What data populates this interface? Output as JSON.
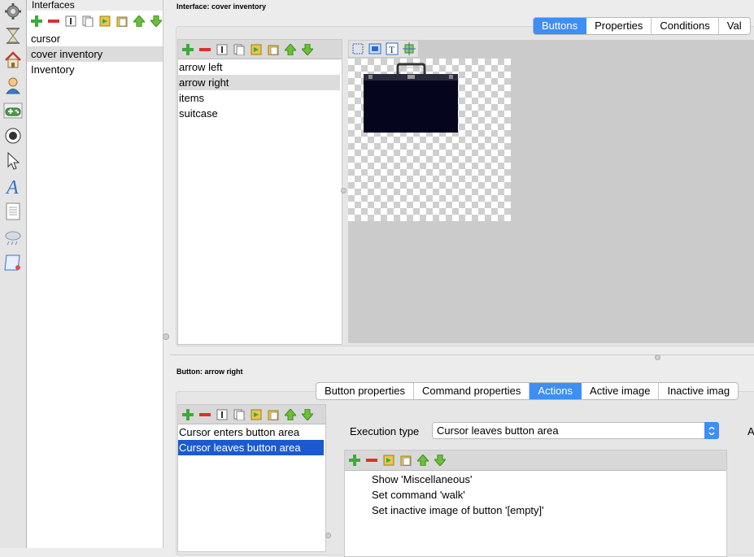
{
  "icons": {
    "add": "plus-icon",
    "remove": "minus-icon",
    "rename": "rename-icon",
    "copy": "copy-icon",
    "paste": "paste-icon",
    "move_up": "arrow-up-icon",
    "move_down": "arrow-down-icon"
  },
  "colors": {
    "accent": "#3d8ef5",
    "selection_blue": "#1b5ad0",
    "suitcase": "#05051e"
  },
  "interfaces": {
    "title": "Interfaces",
    "items": [
      {
        "label": "cursor",
        "selected": false
      },
      {
        "label": "cover inventory",
        "selected": true
      },
      {
        "label": "Inventory",
        "selected": false
      }
    ]
  },
  "interface_panel": {
    "title": "Interface: cover inventory",
    "tabs": [
      {
        "label": "Buttons",
        "active": true
      },
      {
        "label": "Properties",
        "active": false
      },
      {
        "label": "Conditions",
        "active": false
      },
      {
        "label": "Val",
        "active": false
      }
    ],
    "buttons_list": [
      {
        "label": "arrow left",
        "selected": false
      },
      {
        "label": "arrow right",
        "selected": true
      },
      {
        "label": "items",
        "selected": false
      },
      {
        "label": "suitcase",
        "selected": false
      }
    ]
  },
  "button_panel": {
    "title": "Button: arrow right",
    "tabs": [
      {
        "label": "Button properties",
        "active": false
      },
      {
        "label": "Command properties",
        "active": false
      },
      {
        "label": "Actions",
        "active": true
      },
      {
        "label": "Active image",
        "active": false
      },
      {
        "label": "Inactive imag",
        "active": false
      }
    ],
    "events": [
      {
        "label": "Cursor enters button area",
        "selected": false
      },
      {
        "label": "Cursor leaves button area",
        "selected": true
      }
    ],
    "execution_type_label": "Execution type",
    "execution_type_value": "Cursor leaves button area",
    "right_edge_label": "A",
    "actions": [
      "Show 'Miscellaneous'",
      "Set command 'walk'",
      "Set inactive image of button '[empty]'"
    ]
  }
}
